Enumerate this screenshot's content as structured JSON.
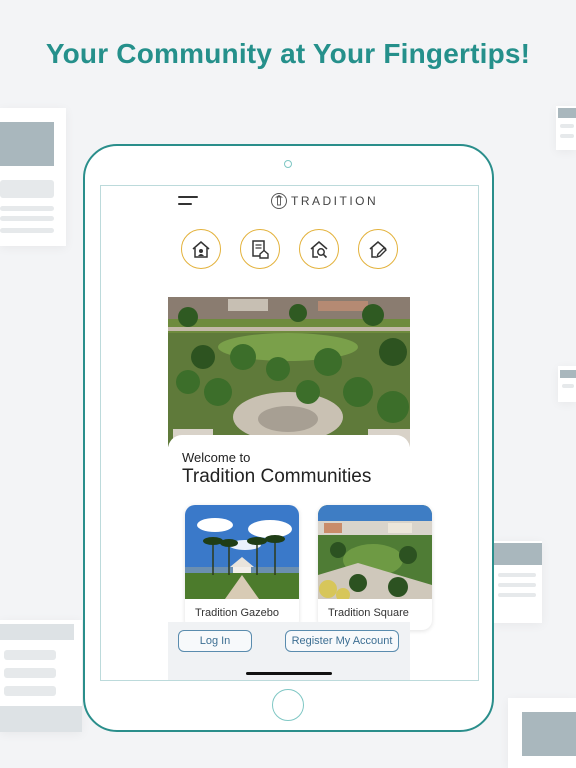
{
  "headline": "Your Community at Your Fingertips!",
  "app": {
    "brand": "TRADITION",
    "icons": [
      "home-person-icon",
      "document-home-icon",
      "home-search-icon",
      "home-edit-icon"
    ],
    "welcome_small": "Welcome to",
    "welcome_big": "Tradition Communities",
    "places": [
      {
        "label": "Tradition Gazebo"
      },
      {
        "label": "Tradition Square"
      }
    ],
    "login_label": "Log In",
    "register_label": "Register My Account"
  },
  "colors": {
    "headline": "#25908b",
    "tablet_frame": "#2a8e8b",
    "icon_ring": "#e3b23c",
    "button_border": "#5a8cae"
  }
}
